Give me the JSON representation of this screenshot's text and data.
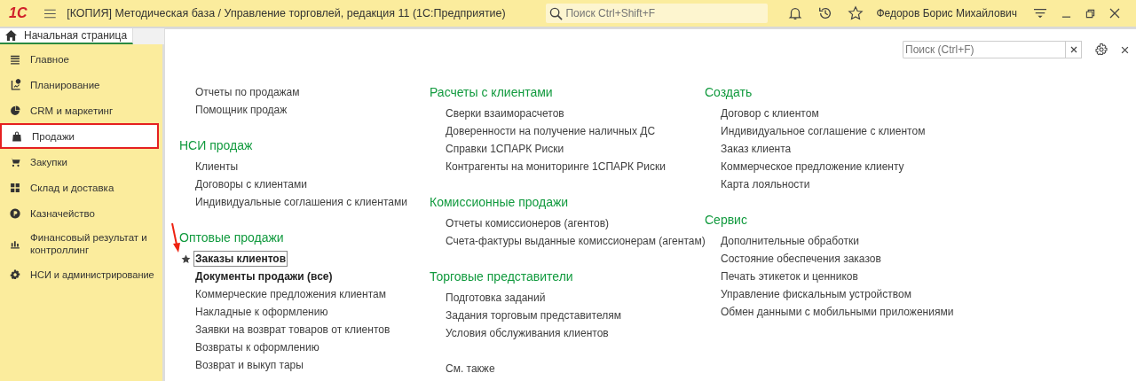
{
  "header": {
    "logo": "1С",
    "title": "[КОПИЯ] Методическая база / Управление торговлей, редакция 11  (1С:Предприятие)",
    "search": {
      "placeholder": "Поиск Ctrl+Shift+F"
    },
    "user": "Федоров Борис Михайлович"
  },
  "tabs": [
    {
      "label": "Начальная страница",
      "selected": true
    }
  ],
  "sidebar": {
    "items": [
      {
        "label": "Главное",
        "selected": false
      },
      {
        "label": "Планирование",
        "selected": false
      },
      {
        "label": "CRM и маркетинг",
        "selected": false
      },
      {
        "label": "Продажи",
        "selected": true
      },
      {
        "label": "Закупки",
        "selected": false
      },
      {
        "label": "Склад и доставка",
        "selected": false
      },
      {
        "label": "Казначейство",
        "selected": false
      },
      {
        "label": "Финансовый результат и контроллинг",
        "selected": false
      },
      {
        "label": "НСИ и администрирование",
        "selected": false
      }
    ]
  },
  "content": {
    "search": {
      "placeholder": "Поиск (Ctrl+F)"
    },
    "columns": [
      {
        "groups": [
          {
            "links": [
              {
                "label": "Отчеты по продажам",
                "bold": false,
                "favorite": false,
                "selected": false
              },
              {
                "label": "Помощник продаж",
                "bold": false,
                "favorite": false,
                "selected": false
              }
            ]
          },
          {
            "title": "НСИ продаж",
            "links": [
              {
                "label": "Клиенты",
                "bold": false,
                "favorite": false,
                "selected": false
              },
              {
                "label": "Договоры с клиентами",
                "bold": false,
                "favorite": false,
                "selected": false
              },
              {
                "label": "Индивидуальные соглашения с клиентами",
                "bold": false,
                "favorite": false,
                "selected": false
              }
            ]
          },
          {
            "title": "Оптовые продажи",
            "links": [
              {
                "label": "Заказы клиентов",
                "bold": true,
                "favorite": true,
                "selected": true
              },
              {
                "label": "Документы продажи (все)",
                "bold": true,
                "favorite": false,
                "selected": false
              },
              {
                "label": "Коммерческие предложения клиентам",
                "bold": false,
                "favorite": false,
                "selected": false
              },
              {
                "label": "Накладные к оформлению",
                "bold": false,
                "favorite": false,
                "selected": false
              },
              {
                "label": "Заявки на возврат товаров от клиентов",
                "bold": false,
                "favorite": false,
                "selected": false
              },
              {
                "label": "Возвраты к оформлению",
                "bold": false,
                "favorite": false,
                "selected": false
              },
              {
                "label": "Возврат и выкуп тары",
                "bold": false,
                "favorite": false,
                "selected": false
              }
            ]
          }
        ]
      },
      {
        "groups": [
          {
            "title": "Расчеты с клиентами",
            "links": [
              {
                "label": "Сверки взаиморасчетов",
                "bold": false,
                "favorite": false,
                "selected": false
              },
              {
                "label": "Доверенности на получение наличных ДС",
                "bold": false,
                "favorite": false,
                "selected": false
              },
              {
                "label": "Справки 1СПАРК Риски",
                "bold": false,
                "favorite": false,
                "selected": false
              },
              {
                "label": "Контрагенты на мониторинге 1СПАРК Риски",
                "bold": false,
                "favorite": false,
                "selected": false
              }
            ]
          },
          {
            "title": "Комиссионные продажи",
            "links": [
              {
                "label": "Отчеты комиссионеров (агентов)",
                "bold": false,
                "favorite": false,
                "selected": false
              },
              {
                "label": "Счета-фактуры выданные комиссионерам (агентам)",
                "bold": false,
                "favorite": false,
                "selected": false
              }
            ]
          },
          {
            "title": "Торговые представители",
            "links": [
              {
                "label": "Подготовка заданий",
                "bold": false,
                "favorite": false,
                "selected": false
              },
              {
                "label": "Задания торговым представителям",
                "bold": false,
                "favorite": false,
                "selected": false
              },
              {
                "label": "Условия обслуживания клиентов",
                "bold": false,
                "favorite": false,
                "selected": false
              }
            ]
          },
          {
            "links": [
              {
                "label": "См. также",
                "bold": false,
                "favorite": false,
                "selected": false
              }
            ]
          }
        ]
      },
      {
        "groups": [
          {
            "title": "Создать",
            "links": [
              {
                "label": "Договор с клиентом",
                "bold": false,
                "favorite": false,
                "selected": false
              },
              {
                "label": "Индивидуальное соглашение с клиентом",
                "bold": false,
                "favorite": false,
                "selected": false
              },
              {
                "label": "Заказ клиента",
                "bold": false,
                "favorite": false,
                "selected": false
              },
              {
                "label": "Коммерческое предложение клиенту",
                "bold": false,
                "favorite": false,
                "selected": false
              },
              {
                "label": "Карта лояльности",
                "bold": false,
                "favorite": false,
                "selected": false
              }
            ]
          },
          {
            "title": "Сервис",
            "links": [
              {
                "label": "Дополнительные обработки",
                "bold": false,
                "favorite": false,
                "selected": false
              },
              {
                "label": "Состояние обеспечения заказов",
                "bold": false,
                "favorite": false,
                "selected": false
              },
              {
                "label": "Печать этикеток и ценников",
                "bold": false,
                "favorite": false,
                "selected": false
              },
              {
                "label": "Управление фискальным устройством",
                "bold": false,
                "favorite": false,
                "selected": false
              },
              {
                "label": "Обмен данными с мобильными приложениями",
                "bold": false,
                "favorite": false,
                "selected": false
              }
            ]
          }
        ]
      }
    ]
  }
}
